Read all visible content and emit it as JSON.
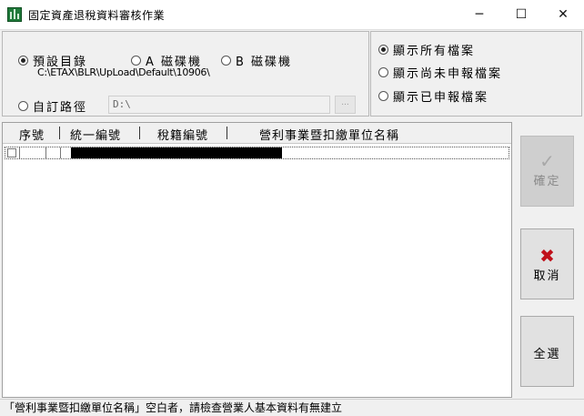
{
  "window": {
    "title": "固定資產退稅資料審核作業",
    "minimize_glyph": "─",
    "maximize_glyph": "☐",
    "close_glyph": "✕",
    "icon": "spreadsheet-chart-icon"
  },
  "source": {
    "options": {
      "preset": "預設目錄",
      "drive_a": "A 磁碟機",
      "drive_b": "B 磁碟機",
      "custom": "自訂路徑"
    },
    "selected": "preset",
    "preset_path": "C:\\ETAX\\BLR\\UpLoad\\Default\\10906\\",
    "custom_path_value": "D:\\",
    "browse_label": "..."
  },
  "filter": {
    "options": {
      "all": "顯示所有檔案",
      "unreported": "顯示尚未申報檔案",
      "reported": "顯示已申報檔案"
    },
    "selected": "all"
  },
  "table": {
    "columns": [
      "序號",
      "統一編號",
      "稅籍編號",
      "營利事業暨扣繳單位名稱"
    ],
    "separator": "|",
    "rows": [
      {
        "checked": false,
        "seq": "",
        "unified_id": "",
        "tax_id": "",
        "name_redacted": true
      }
    ]
  },
  "buttons": {
    "confirm": {
      "label": "確定",
      "icon": "check-icon",
      "glyph": "✓",
      "enabled": false
    },
    "cancel": {
      "label": "取消",
      "icon": "close-x-icon",
      "glyph": "✖",
      "color": "#c0101a"
    },
    "select_all": {
      "label": "全選"
    }
  },
  "status_bar": {
    "message": "「營利事業暨扣繳單位名稱」空白者，請檢查營業人基本資料有無建立"
  }
}
